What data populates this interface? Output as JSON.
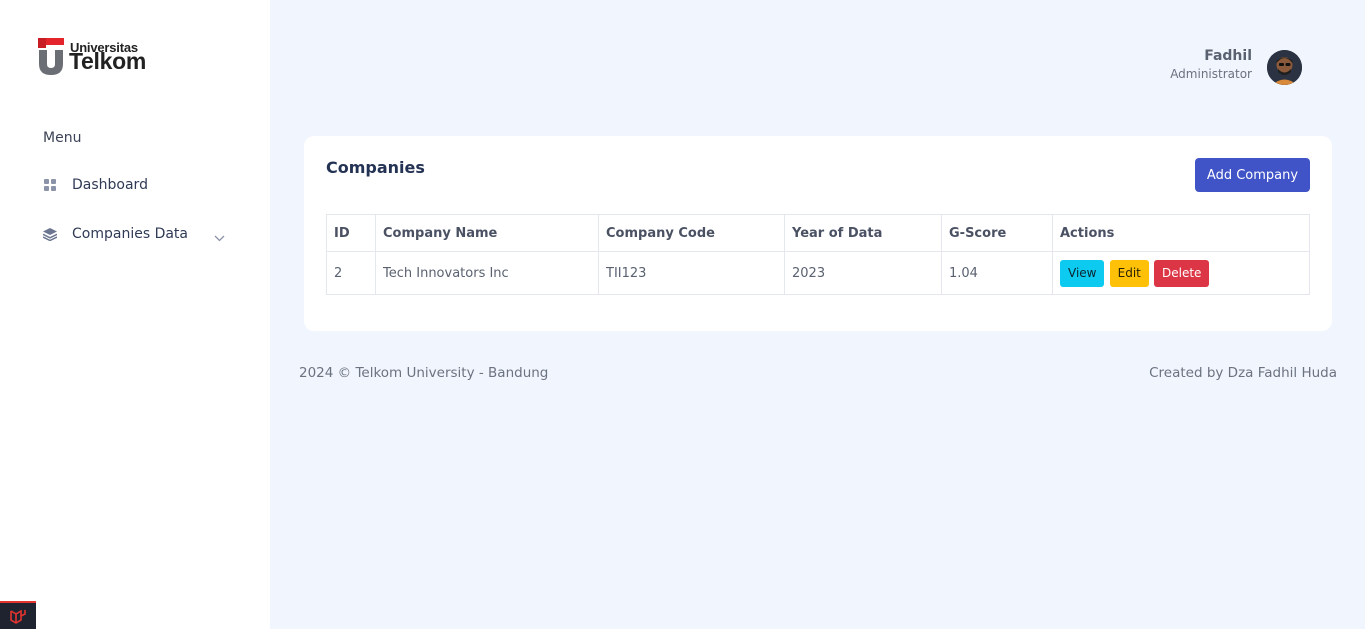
{
  "brand": {
    "line1": "Universitas",
    "line2": "Telkom",
    "accent_color": "#e3242b"
  },
  "sidebar": {
    "menu_heading": "Menu",
    "items": [
      {
        "label": "Dashboard",
        "icon": "grid-icon"
      },
      {
        "label": "Companies Data",
        "icon": "layers-icon",
        "expandable": true
      }
    ]
  },
  "user": {
    "name": "Fadhil",
    "role": "Administrator"
  },
  "page": {
    "title": "Companies",
    "add_button": "Add Company",
    "accent": "#4154c7"
  },
  "table": {
    "columns": [
      "ID",
      "Company Name",
      "Company Code",
      "Year of Data",
      "G-Score",
      "Actions"
    ],
    "rows": [
      {
        "id": "2",
        "name": "Tech Innovators Inc",
        "code": "TII123",
        "year": "2023",
        "gscore": "1.04"
      }
    ],
    "actions": {
      "view": "View",
      "edit": "Edit",
      "delete": "Delete"
    }
  },
  "footer": {
    "left": "2024 © Telkom University - Bandung",
    "right": "Created by Dza Fadhil Huda"
  }
}
